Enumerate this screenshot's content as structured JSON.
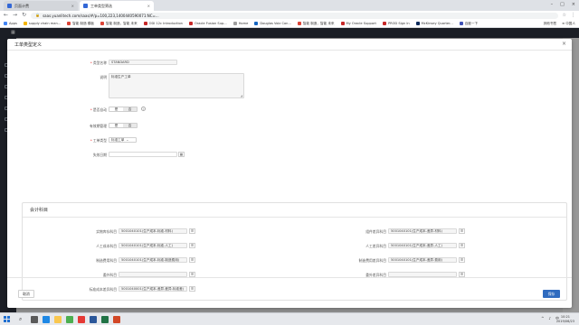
{
  "browser": {
    "tabs": [
      {
        "title": "页面计费",
        "active": false
      },
      {
        "title": "工单类型筛选",
        "active": true
      }
    ],
    "url": "saas.yuanlitech.com/saas/#/p=100,223,1400440590071:NC=..."
  },
  "bookmarks": {
    "items": [
      {
        "label": "Apps",
        "color": "#4285f4"
      },
      {
        "label": "supply chain man...",
        "color": "#f4b400"
      },
      {
        "label": "智能 制造 模板",
        "color": "#db4437"
      },
      {
        "label": "智能 制造，智能 未来",
        "color": "#db4437"
      },
      {
        "label": "ODI 12c Introduction",
        "color": "#c62828"
      },
      {
        "label": "Oracle Fusion Sup...",
        "color": "#c62828"
      },
      {
        "label": "Home",
        "color": "#9e9e9e"
      },
      {
        "label": "Douglas Volz Con...",
        "color": "#1565c0"
      },
      {
        "label": "智能 制造，智能 未来",
        "color": "#db4437"
      },
      {
        "label": "My Oracle Support",
        "color": "#c62828"
      },
      {
        "label": "PROD Sign In",
        "color": "#c62828"
      },
      {
        "label": "McKinsey Quarter...",
        "color": "#0d2b5c"
      },
      {
        "label": "百度一下",
        "color": "#3f51b5"
      }
    ],
    "right": [
      "其他书签",
      "≡ 中国人"
    ]
  },
  "modal": {
    "title": "工单类型定义",
    "close": "×",
    "fields": {
      "type_name_label": "类型名称",
      "type_name_value": "STANDARD",
      "desc_label": "说明",
      "desc_value": "标准生产工单",
      "sync_label": "是否自动",
      "yes": "是",
      "no": "否",
      "manage_label": "有效期管理",
      "kind_label": "工单类型",
      "kind_value": "标准工单",
      "expire_label": "失效日期",
      "cal_icon": "▦"
    },
    "accounts": {
      "title": "会计科目",
      "left": [
        {
          "label": "实物库存科目",
          "value": "5001040101(生产成本-标准-材料)",
          "filled": true
        },
        {
          "label": "人工成本科目",
          "value": "5001040101(生产成本-标准-人工)",
          "filled": true
        },
        {
          "label": "制造费用科目",
          "value": "5001040101(生产成本-标准-制造费用)",
          "filled": true
        },
        {
          "label": "委外科目",
          "value": "",
          "filled": false
        },
        {
          "label": "标准成本差异科目",
          "value": "5001040001(生产成本-差异-差异-标准差)",
          "filled": true
        }
      ],
      "right": [
        {
          "label": "组件差异科目",
          "value": "5001040101(生产成本-差异-材料)",
          "filled": true
        },
        {
          "label": "人工差异科目",
          "value": "5001040101(生产成本-差异-人工)",
          "filled": true
        },
        {
          "label": "制造费用差异科目",
          "value": "5001040101(生产成本-差异-费用)",
          "filled": true
        },
        {
          "label": "委外差异科目",
          "value": "",
          "filled": false
        }
      ]
    },
    "buttons": {
      "cancel": "取消",
      "save": "保存"
    }
  },
  "taskbar": {
    "time": "10:21",
    "date": "2019/06/23",
    "tray": [
      "^",
      "♪",
      "中"
    ]
  },
  "colors": {
    "accent": "#2f6bbf",
    "required": "#e33",
    "header": "#2a2f3a"
  }
}
